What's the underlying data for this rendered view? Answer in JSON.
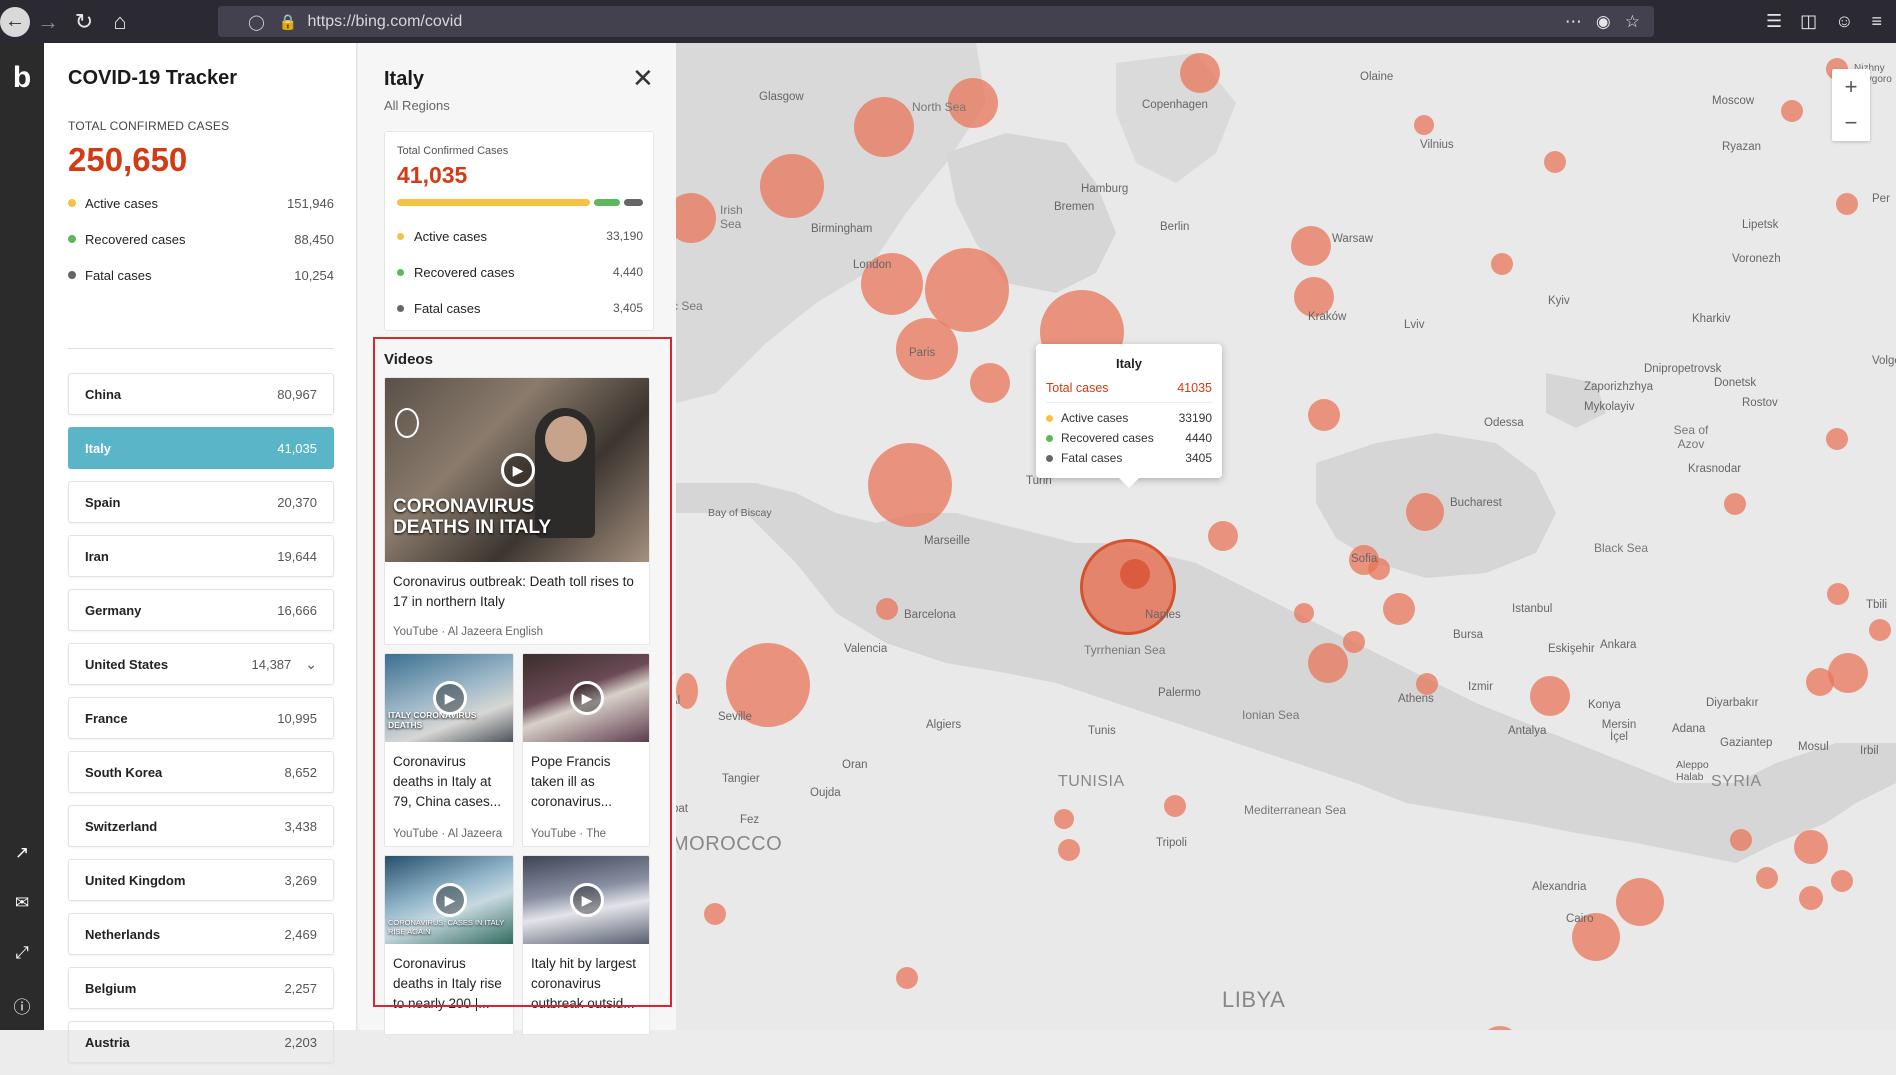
{
  "browser": {
    "url": "https://bing.com/covid"
  },
  "tracker": {
    "title": "COVID-19 Tracker",
    "total_label": "TOTAL CONFIRMED CASES",
    "total_value": "250,650",
    "stats": [
      {
        "label": "Active cases",
        "value": "151,946",
        "color": "#f5c243"
      },
      {
        "label": "Recovered cases",
        "value": "88,450",
        "color": "#5cb85c"
      },
      {
        "label": "Fatal cases",
        "value": "10,254",
        "color": "#666666"
      }
    ],
    "countries": [
      {
        "name": "China",
        "value": "80,967"
      },
      {
        "name": "Italy",
        "value": "41,035"
      },
      {
        "name": "Spain",
        "value": "20,370"
      },
      {
        "name": "Iran",
        "value": "19,644"
      },
      {
        "name": "Germany",
        "value": "16,666"
      },
      {
        "name": "United States",
        "value": "14,387"
      },
      {
        "name": "France",
        "value": "10,995"
      },
      {
        "name": "South Korea",
        "value": "8,652"
      },
      {
        "name": "Switzerland",
        "value": "3,438"
      },
      {
        "name": "United Kingdom",
        "value": "3,269"
      },
      {
        "name": "Netherlands",
        "value": "2,469"
      },
      {
        "name": "Belgium",
        "value": "2,257"
      },
      {
        "name": "Austria",
        "value": "2,203"
      }
    ]
  },
  "detail": {
    "title": "Italy",
    "subtitle": "All Regions",
    "card": {
      "label": "Total Confirmed Cases",
      "value": "41,035",
      "stats": [
        {
          "label": "Active cases",
          "value": "33,190",
          "color": "#f5c243"
        },
        {
          "label": "Recovered cases",
          "value": "4,440",
          "color": "#5cb85c"
        },
        {
          "label": "Fatal cases",
          "value": "3,405",
          "color": "#666666"
        }
      ]
    },
    "videos_title": "Videos",
    "videos": [
      {
        "title": "Coronavirus outbreak: Death toll rises to 17 in northern Italy",
        "source": "YouTube · Al Jazeera English",
        "overlay": "CORONAVIRUS DEATHS IN ITALY"
      },
      {
        "title": "Coronavirus deaths in Italy at 79, China cases...",
        "source": "YouTube · Al Jazeera",
        "overlay": "ITALY CORONAVIRUS DEATHS"
      },
      {
        "title": "Pope Francis taken ill as coronavirus...",
        "source": "YouTube · The",
        "overlay": ""
      },
      {
        "title": "Coronavirus deaths in Italy rise to nearly 200 |...",
        "source": "",
        "overlay": "CORONAVIRUS: CASES IN ITALY RISE AGAIN"
      },
      {
        "title": "Italy hit by largest coronavirus outbreak outsid...",
        "source": "",
        "overlay": ""
      }
    ]
  },
  "tooltip": {
    "title": "Italy",
    "total_label": "Total cases",
    "total_value": "41035",
    "rows": [
      {
        "label": "Active cases",
        "value": "33190",
        "color": "#f5c243"
      },
      {
        "label": "Recovered cases",
        "value": "4440",
        "color": "#5cb85c"
      },
      {
        "label": "Fatal cases",
        "value": "3405",
        "color": "#666666"
      }
    ]
  },
  "map_labels": {
    "glasgow": "Glasgow",
    "north_sea": "North Sea",
    "copenhagen": "Copenhagen",
    "oslo_olaine": "Olaine",
    "moscow": "Moscow",
    "irish_sea": "Irish Sea",
    "birmingham": "Birmingham",
    "london": "London",
    "hamburg": "Hamburg",
    "bremen": "Bremen",
    "berlin": "Berlin",
    "warsaw": "Warsaw",
    "vilnius": "Vilnius",
    "ryazan": "Ryazan",
    "lipetsk": "Lipetsk",
    "voronezh": "Voronezh",
    "kyiv": "Kyiv",
    "kharkiv": "Kharkiv",
    "krakow": "Kraków",
    "lviv": "Lviv",
    "paris": "Paris",
    "dnipro": "Dnipropetrovsk",
    "zaporizhzhia": "Zaporizhzhya",
    "donetsk": "Donetsk",
    "mykolaiv": "Mykolayiv",
    "rostov": "Rostov",
    "odessa": "Odessa",
    "sea_azov": "Sea of Azov",
    "krasnodar": "Krasnodar",
    "bay_biscay": "Bay of Biscay",
    "turin": "Turin",
    "bucharest": "Bucharest",
    "black_sea": "Black Sea",
    "marseille": "Marseille",
    "sofia": "Sofia",
    "barcelona": "Barcelona",
    "naples": "Naples",
    "istanbul": "Istanbul",
    "valencia": "Valencia",
    "tyrrhenian": "Tyrrhenian Sea",
    "bursa": "Bursa",
    "eskisehir": "Eskişehir",
    "ankara": "Ankara",
    "izmir": "Izmir",
    "palermo": "Palermo",
    "ionian": "Ionian Sea",
    "athens": "Athens",
    "konya": "Konya",
    "diyarbakir": "Diyarbakır",
    "seville": "Seville",
    "algiers": "Algiers",
    "tunis": "Tunis",
    "mersin": "Mersin İçel",
    "adana": "Adana",
    "antalya": "Antalya",
    "gaziantep": "Gaziantep",
    "mosul": "Mosul",
    "oran": "Oran",
    "tangier": "Tangier",
    "oujda": "Oujda",
    "fez": "Fez",
    "tunisia": "TUNISIA",
    "aleppo": "Aleppo Halab",
    "syria": "SYRIA",
    "mediterranean": "Mediterranean Sea",
    "morocco": "MOROCCO",
    "tripoli": "Tripoli",
    "alexandria": "Alexandria",
    "cairo": "Cairo",
    "libya": "LIBYA",
    "celtic_sea": "c Sea",
    "rabat": "bat",
    "nizhny": "Nizhny Novgoro",
    "volgo": "Volgo",
    "perm": "Per",
    "erbil": "Irbil",
    "tbilisi": "Tbili",
    "dakar_ali": "Al"
  },
  "map_bubble_color": "#e8765a"
}
